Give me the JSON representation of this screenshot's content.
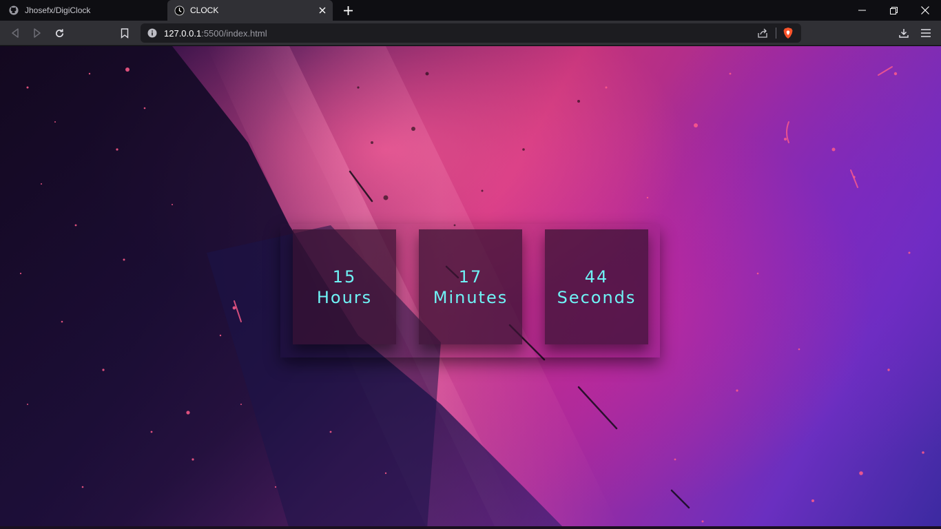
{
  "browser": {
    "tabs": [
      {
        "title": "Jhosefx/DigiClock",
        "favicon": "github-icon",
        "active": false
      },
      {
        "title": "CLOCK",
        "favicon": "clock-icon",
        "active": true
      }
    ],
    "address": {
      "host": "127.0.0.1",
      "rest": ":5500/index.html"
    },
    "icons": [
      "back-icon",
      "forward-icon",
      "reload-icon",
      "bookmark-icon",
      "info-icon",
      "share-icon",
      "brave-shield-icon",
      "download-icon",
      "menu-icon",
      "minimize-icon",
      "restore-icon",
      "close-window-icon",
      "new-tab-icon"
    ]
  },
  "clock": {
    "hours": {
      "value": "15",
      "label": "Hours"
    },
    "minutes": {
      "value": "17",
      "label": "Minutes"
    },
    "seconds": {
      "value": "44",
      "label": "Seconds"
    }
  },
  "colors": {
    "clock_text": "#6ff3f6",
    "chrome_dark": "#0e0e12",
    "chrome_toolbar": "#303035",
    "brave_orange": "#fb542b"
  }
}
